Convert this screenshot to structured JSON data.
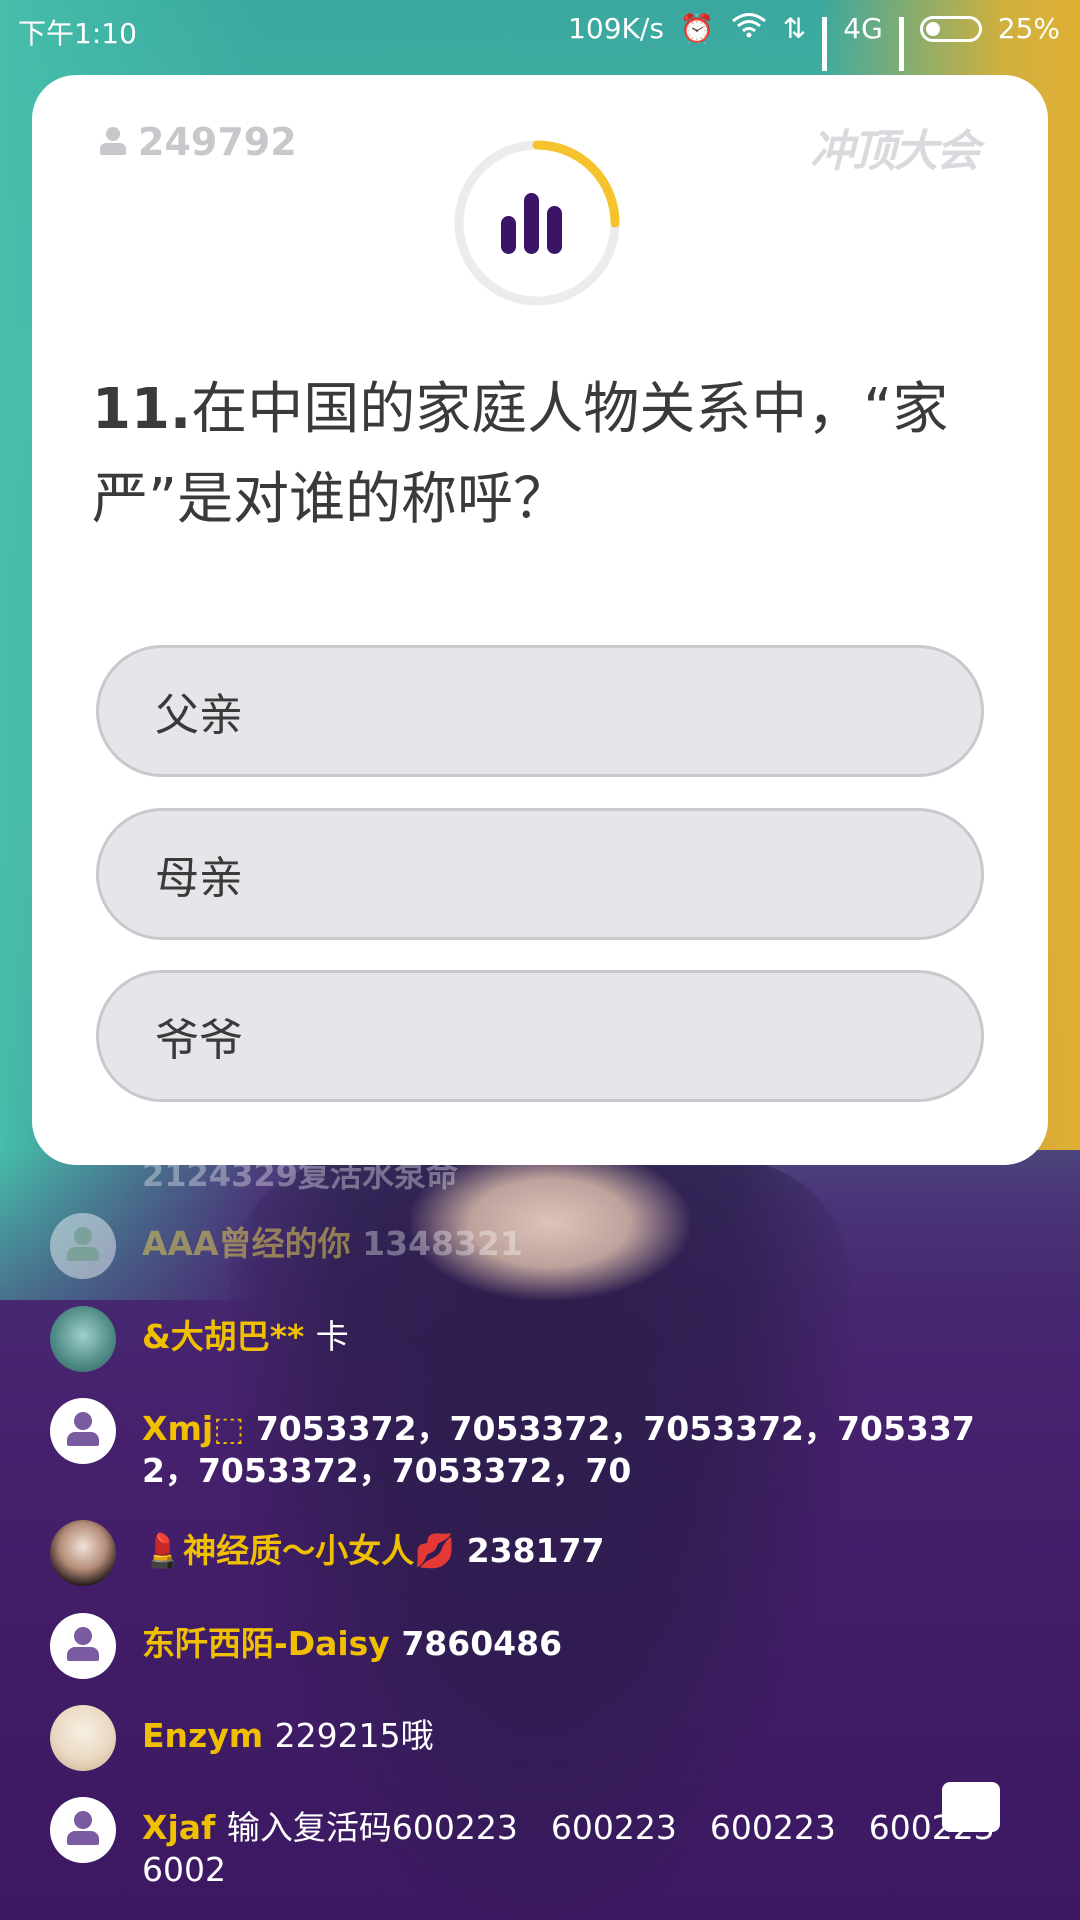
{
  "status_bar": {
    "time": "下午1:10",
    "speed": "109K/s",
    "network": "4G",
    "battery": "25%"
  },
  "quiz": {
    "viewer_count": "249792",
    "brand": "冲顶大会",
    "timer_progress": 0.25,
    "question_number": "11.",
    "question_text": "在中国的家庭人物关系中，“家严”是对谁的称呼？",
    "options": [
      "父亲",
      "母亲",
      "爷爷"
    ]
  },
  "faded_line": "2124329复活水泵命",
  "comments": [
    {
      "name": "AAA曾经的你",
      "text": "1348321"
    },
    {
      "name": "&大胡巴**",
      "text": "卡"
    },
    {
      "name": "Xmj⬚",
      "text": "7053372，7053372，7053372，7053372，7053372，7053372，70"
    },
    {
      "name": "💄神经质～小女人💋",
      "text": "238177"
    },
    {
      "name": "东阡西陌-Daisy",
      "text": "7860486"
    },
    {
      "name": "Enzym",
      "text": "229215哦"
    },
    {
      "name": "Xjaf",
      "text": "输入复活码600223　600223　600223　600223 6002"
    }
  ],
  "colors": {
    "accent": "#f0c000",
    "timer_ring": "#f6c32d",
    "icon_purple": "#3a1466"
  }
}
